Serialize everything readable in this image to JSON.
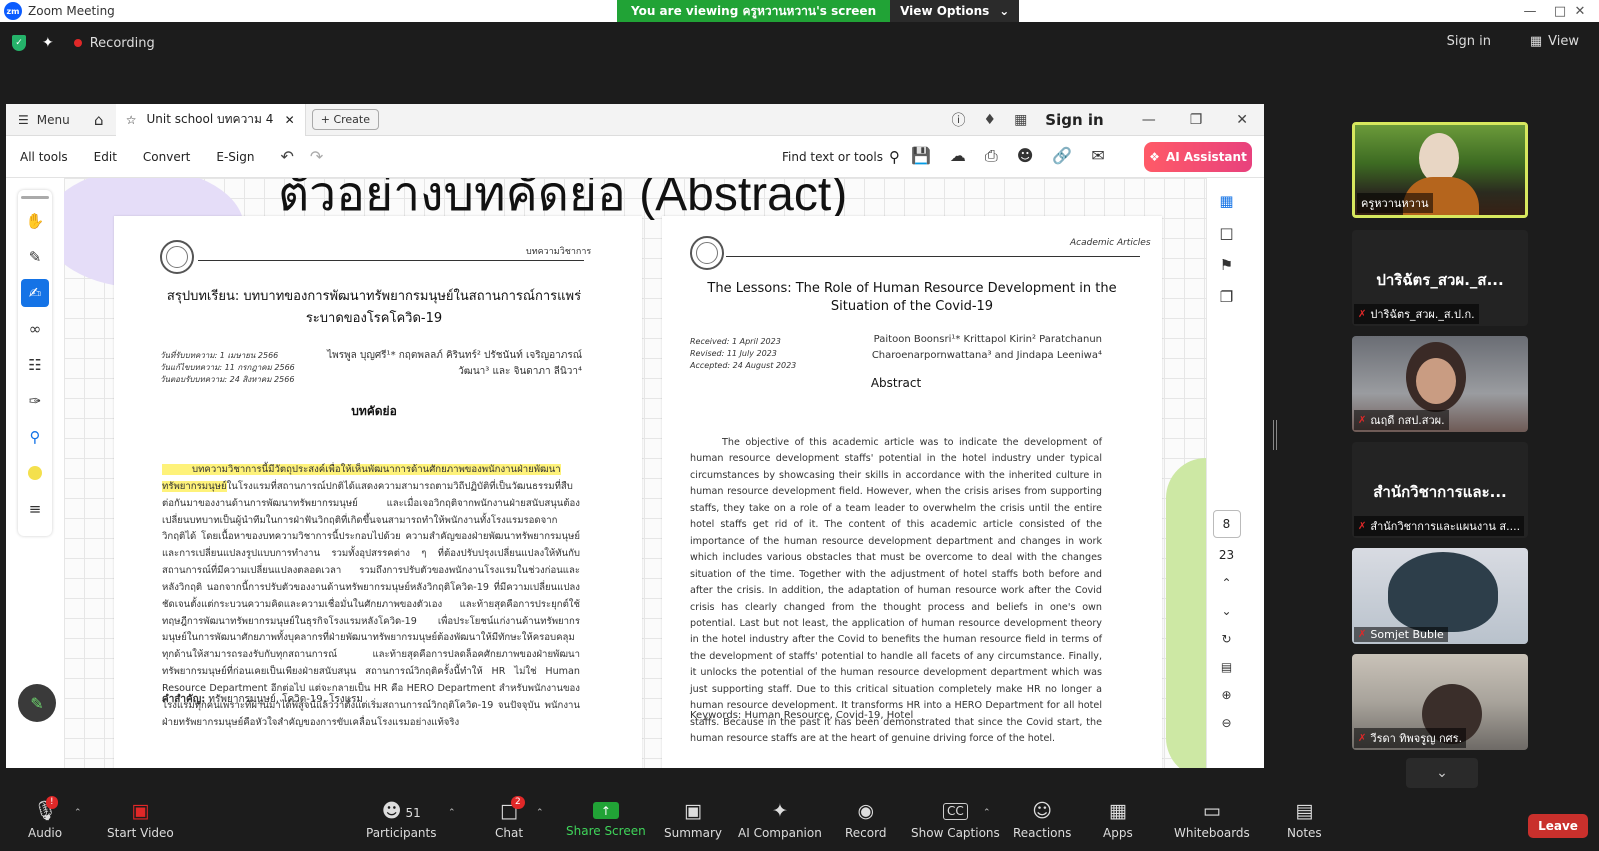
{
  "window": {
    "title": "Zoom Meeting"
  },
  "banner": {
    "message": "You are viewing ครูหวานหวาน's screen",
    "options": "View Options"
  },
  "status": {
    "recording": "Recording",
    "signin": "Sign in",
    "view": "View"
  },
  "acrobat": {
    "menu": "Menu",
    "tab_title": "Unit school บทความ 4",
    "create": "Create",
    "signin": "Sign in",
    "tools": [
      "All tools",
      "Edit",
      "Convert",
      "E-Sign"
    ],
    "find": "Find text or tools",
    "ai_assistant": "AI Assistant",
    "page_current": "8",
    "page_total": "23"
  },
  "doc": {
    "big_title": "ตัวอย่างบทคัดย่อ (Abstract)",
    "thai": {
      "tag": "บทความวิชาการ",
      "title": "สรุปบทเรียน: บทบาทของการพัฒนาทรัพยากรมนุษย์ในสถานการณ์การแพร่ระบาดของโรคโควิด-19",
      "meta": [
        "วันที่รับบทความ: 1 เมษายน 2566",
        "วันแก้ไขบทความ: 11 กรกฎาคม 2566",
        "วันตอบรับบทความ: 24 สิงหาคม 2566"
      ],
      "authors": "ไพรพูล บุญศรี¹* กฤตพลลภ์ คิรินทร์² ปรัชนันท์ เจริญอาภรณ์วัฒนา³ และ จินดาภา ลีนิวา⁴",
      "abstract_heading": "บทคัดย่อ",
      "highlight": "บทความวิชาการนี้มีวัตถุประสงค์เพื่อให้เห็นพัฒนาการด้านศักยภาพของพนักงานฝ่ายพัฒนาทรัพยากรมนุษย์",
      "body": "ในโรงแรมที่สถานการณ์ปกติได้แสดงความสามารถตามวิถีปฏิบัติที่เป็นวัฒนธรรมที่สืบต่อกันมาของงานด้านการพัฒนาทรัพยากรมนุษย์ และเมื่อเจอวิกฤติจากพนักงานฝ่ายสนับสนุนต้องเปลี่ยนบทบาทเป็นผู้นำทีมในการฝ่าฟันวิกฤติที่เกิดขึ้นจนสามารถทำให้พนักงานทั้งโรงแรมรอดจากวิกฤติได้ โดยเนื้อหาของบทความวิชาการนี้ประกอบไปด้วย ความสำคัญของฝ่ายพัฒนาทรัพยากรมนุษย์และการเปลี่ยนแปลงรูปแบบการทำงาน รวมทั้งอุปสรรคต่าง ๆ ที่ต้องปรับปรุงเปลี่ยนแปลงให้ทันกับสถานการณ์ที่มีความเปลี่ยนแปลงตลอดเวลา รวมถึงการปรับตัวของพนักงานโรงแรมในช่วงก่อนและหลังวิกฤติ นอกจากนี้การปรับตัวของงานด้านทรัพยากรมนุษย์หลังวิกฤติโควิด-19 ที่มีความเปลี่ยนแปลงชัดเจนตั้งแต่กระบวนความคิดและความเชื่อมั่นในศักยภาพของตัวเอง และท้ายสุดคือการประยุกต์ใช้ทฤษฎีการพัฒนาทรัพยากรมนุษย์ในธุรกิจโรงแรมหลังโควิด-19 เพื่อประโยชน์แก่งานด้านทรัพยากรมนุษย์ในการพัฒนาศักยภาพทั้งบุคลากรที่ฝ่ายพัฒนาทรัพยากรมนุษย์ต้องพัฒนาให้มีทักษะให้ครอบคลุมทุกด้านให้สามารถรองรับกับทุกสถานการณ์ และท้ายสุดคือการปลดล็อคศักยภาพของฝ่ายพัฒนาทรัพยากรมนุษย์ที่ก่อนเคยเป็นเพียงฝ่ายสนับสนุน สถานการณ์วิกฤติครั้งนี้ทำให้ HR ไม่ใช่ Human Resource Department อีกต่อไป แต่จะกลายเป็น HR คือ HERO Department สำหรับพนักงานของโรงแรมทุกคนเพราะที่ผ่านมาได้พิสูจน์แล้วว่าตั้งแต่เริ่มสถานการณ์วิกฤติโควิด-19 จนปัจจุบัน พนักงานฝ่ายทรัพยากรมนุษย์คือหัวใจสำคัญของการขับเคลื่อนโรงแรมอย่างแท้จริง",
      "keywords_label": "คำสำคัญ:",
      "keywords": " ทรัพยากรมนุษย์, โควิด-19, โรงแรม"
    },
    "english": {
      "tag": "Academic Articles",
      "title": "The Lessons: The Role of Human Resource Development in the Situation of the Covid-19",
      "meta": [
        "Received: 1 April 2023",
        "Revised: 11 July 2023",
        "Accepted: 24 August 2023"
      ],
      "authors": "Paitoon Boonsri¹* Krittapol Kirin² Paratchanun Charoenarpornwattana³ and Jindapa Leeniwa⁴",
      "abstract_heading": "Abstract",
      "body": "The objective of this academic article was to indicate the development of human resource development staffs' potential in the hotel industry under typical circumstances by showcasing their skills in accordance with the inherited culture in human resource development field. However, when the crisis arises from supporting staffs, they take on a role of a team leader to overwhelm the crisis until the entire hotel staffs get rid of it. The content of this academic article consisted of the importance of the human resource development department and changes in work which includes various obstacles that must be overcome to deal with the changes situation of the time. Together with the adjustment of hotel staffs both before and after the crisis. In addition, the adaptation of human resource work after the Covid crisis has clearly changed from the thought process and beliefs in one's own potential. Last but not least, the application of human resource development theory in the hotel industry after the Covid to benefits the human resource field in terms of the development of staffs' potential to handle all facets of any circumstance. Finally, it unlocks the potential of the human resource development department which was just supporting staff. Due to this critical situation completely make HR no longer a human resource development. It transforms HR into a HERO Department for all hotel staffs. Because in the past it has been demonstrated that since the Covid start, the human resource staffs are at the heart of genuine driving force of the hotel.",
      "keywords_label": "Keywords:",
      "keywords": " Human Resource, Covid-19, Hotel"
    }
  },
  "participants": [
    {
      "name": "ครูหวานหวาน",
      "kind": "video",
      "active": true
    },
    {
      "name": "ปาริฉัตร_สวผ._ส.ป.ก.",
      "display": "ปาริฉัตร_สวผ._ส...",
      "kind": "name"
    },
    {
      "name": "ณฤดี กสป.สวผ.",
      "kind": "video"
    },
    {
      "name": "สำนักวิชาการและแผนงาน ส....",
      "display": "สำนักวิชาการและ...",
      "kind": "name"
    },
    {
      "name": "Somjet Buble",
      "kind": "video"
    },
    {
      "name": "วีรดา ทิพจรูญ กศร.",
      "kind": "video"
    }
  ],
  "toolbar": {
    "audio": "Audio",
    "audio_badge": "!",
    "video": "Start Video",
    "participants": "Participants",
    "participants_count": "51",
    "chat": "Chat",
    "chat_badge": "2",
    "share": "Share Screen",
    "summary": "Summary",
    "ai_companion": "AI Companion",
    "record": "Record",
    "captions": "Show Captions",
    "reactions": "Reactions",
    "apps": "Apps",
    "whiteboards": "Whiteboards",
    "notes": "Notes",
    "leave": "Leave"
  },
  "colors": {
    "share_green": "#21a336",
    "leave_red": "#c9302c",
    "highlight": "#fef27a",
    "active_speaker": "#d7e85e"
  }
}
